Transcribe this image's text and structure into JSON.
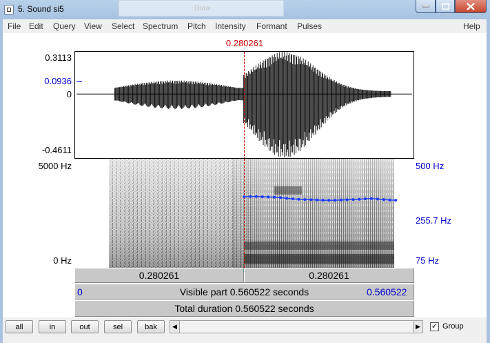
{
  "window": {
    "title": "5. Sound si5",
    "background_dialog_title": "Draw"
  },
  "menu": [
    "File",
    "Edit",
    "Query",
    "View",
    "Select",
    "Spectrum",
    "Pitch",
    "Intensity",
    "Formant",
    "Pulses",
    "Help"
  ],
  "cursor_time": "0.280261",
  "waveform_axis": {
    "max": "0.3113",
    "cursor_value": "0.0936",
    "zero": "0",
    "min": "-0.4611"
  },
  "spectrogram_axis": {
    "top": "5000 Hz",
    "bottom": "0 Hz"
  },
  "pitch_axis": {
    "top": "500 Hz",
    "cursor": "255.7 Hz",
    "bottom": "75 Hz"
  },
  "bars": {
    "left_segment": "0.280261",
    "right_segment": "0.280261",
    "visible_start": "0",
    "visible_label": "Visible part 0.560522 seconds",
    "visible_end": "0.560522",
    "total_label": "Total duration 0.560522 seconds"
  },
  "toolbar": {
    "all": "all",
    "in": "in",
    "out": "out",
    "sel": "sel",
    "bak": "bak",
    "group": "Group",
    "group_checked": true
  },
  "colors": {
    "cursor": "#cc0000",
    "pitch": "#1a3cff",
    "axis_blue": "#0000cc"
  },
  "chart_data": {
    "type": "line",
    "title": "",
    "xlabel": "",
    "ylabel": "",
    "xlim": [
      0,
      0.560522
    ],
    "ylim": [
      75,
      500
    ],
    "series": [
      {
        "x": [
          0.28,
          0.29,
          0.3,
          0.31,
          0.32,
          0.33,
          0.34,
          0.35,
          0.36,
          0.37,
          0.38,
          0.39,
          0.4,
          0.41,
          0.42,
          0.43,
          0.44,
          0.45,
          0.46,
          0.47,
          0.48,
          0.49,
          0.5,
          0.51,
          0.52,
          0.53
        ],
        "values": [
          258,
          259,
          259,
          258,
          257,
          256,
          254,
          251,
          249,
          247,
          246,
          245,
          244,
          243,
          243,
          243,
          244,
          245,
          246,
          247,
          249,
          250,
          248,
          246,
          244,
          243
        ]
      }
    ]
  }
}
